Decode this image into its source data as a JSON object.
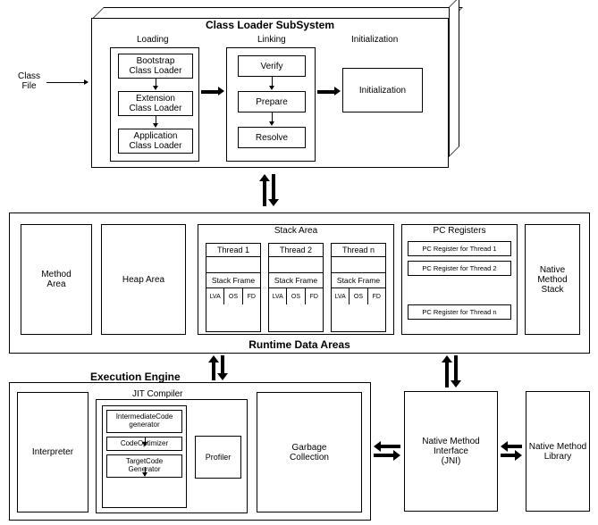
{
  "input": {
    "class_file": "Class\nFile"
  },
  "class_loader": {
    "title": "Class Loader SubSystem",
    "loading": {
      "label": "Loading",
      "bootstrap": "Bootstrap\nClass Loader",
      "extension": "Extension\nClass Loader",
      "application": "Application\nClass Loader"
    },
    "linking": {
      "label": "Linking",
      "verify": "Verify",
      "prepare": "Prepare",
      "resolve": "Resolve"
    },
    "initialization": {
      "label": "Initialization",
      "box": "Initialization"
    }
  },
  "runtime": {
    "title": "Runtime Data Areas",
    "method_area": "Method\nArea",
    "heap_area": "Heap Area",
    "stack_area": {
      "title": "Stack Area",
      "threads": [
        "Thread 1",
        "Thread 2",
        "Thread n"
      ],
      "stack_frame": "Stack Frame",
      "cols": [
        "LVA",
        "OS",
        "FD"
      ]
    },
    "pc_registers": {
      "title": "PC Registers",
      "items": [
        "PC Register for Thread 1",
        "PC Register for Thread 2",
        "PC Register for Thread n"
      ]
    },
    "native_method_stack": "Native\nMethod\nStack"
  },
  "execution": {
    "title": "Execution Engine",
    "interpreter": "Interpreter",
    "jit": {
      "title": "JIT Compiler",
      "intermediate": "IntermediateCode\ngenerator",
      "optimizer": "CodeOptimizer",
      "target": "TargetCode\nGenerator",
      "profiler": "Profiler"
    },
    "gc": "Garbage\nCollection"
  },
  "jni": "Native Method\nInterface\n(JNI)",
  "native_lib": "Native Method\nLibrary"
}
